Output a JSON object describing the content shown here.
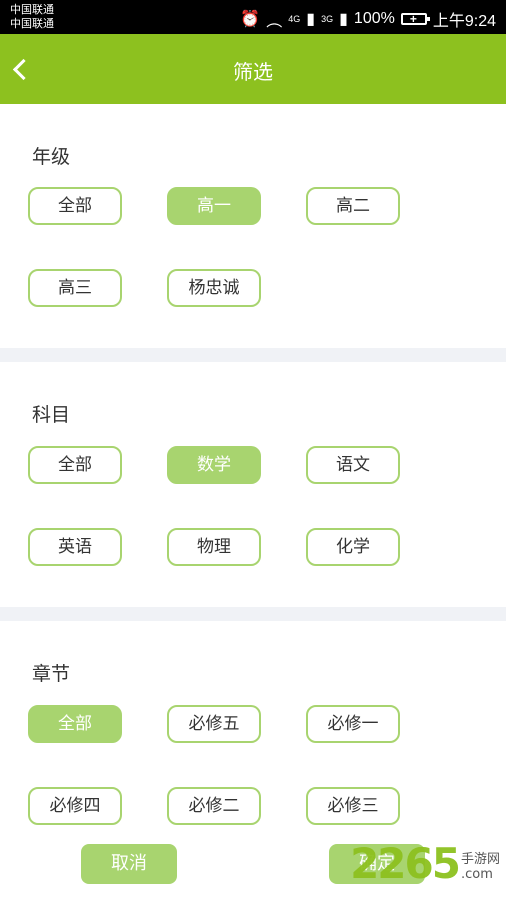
{
  "status": {
    "carrier1": "中国联通",
    "carrier2": "中国联通",
    "signal": "4G",
    "signal2": "3G",
    "battery": "100%",
    "time": "上午9:24"
  },
  "nav": {
    "title": "筛选"
  },
  "sections": [
    {
      "title": "年级",
      "chips": [
        "全部",
        "高一",
        "高二",
        "高三",
        "杨忠诚"
      ],
      "active": 1
    },
    {
      "title": "科目",
      "chips": [
        "全部",
        "数学",
        "语文",
        "英语",
        "物理",
        "化学"
      ],
      "active": 1
    },
    {
      "title": "章节",
      "chips": [
        "全部",
        "必修五",
        "必修一",
        "必修四",
        "必修二",
        "必修三"
      ],
      "active": 0
    }
  ],
  "buttons": {
    "cancel": "取消",
    "confirm": "确定"
  },
  "watermark": {
    "brand": "2265",
    "site": "手游网",
    "domain": ".com"
  },
  "colors": {
    "primary": "#8dc11f",
    "chip": "#a8d46f"
  }
}
